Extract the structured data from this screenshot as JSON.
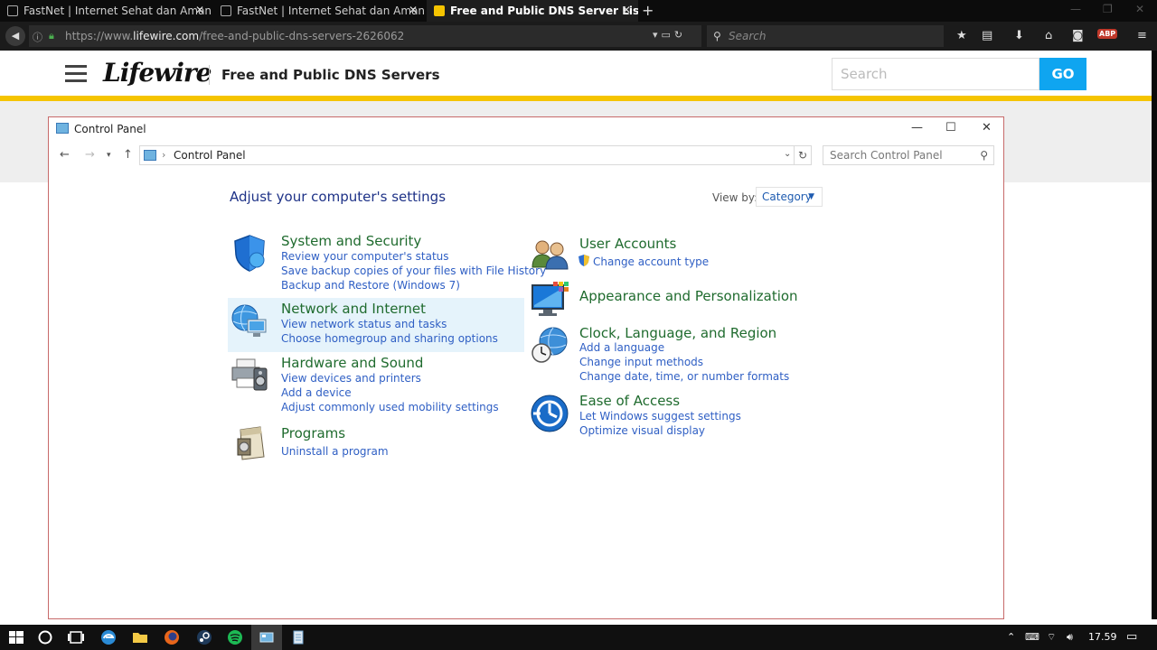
{
  "browser": {
    "tabs": [
      {
        "label": "FastNet | Internet Sehat dan Aman",
        "active": false
      },
      {
        "label": "FastNet | Internet Sehat dan Aman",
        "active": false
      },
      {
        "label": "Free and Public DNS Server List (Jul",
        "active": true
      }
    ],
    "url_prefix": "https://www.",
    "url_host": "lifewire.com",
    "url_path": "/free-and-public-dns-servers-2626062",
    "search_placeholder": "Search"
  },
  "lifewire": {
    "logo": "Lifewire",
    "title": "Free and Public DNS Servers",
    "search_placeholder": "Search",
    "go_label": "GO",
    "accent": "#f5c400",
    "go_color": "#0fa5f0"
  },
  "control_panel": {
    "window_title": "Control Panel",
    "breadcrumb": "Control Panel",
    "search_placeholder": "Search Control Panel",
    "heading": "Adjust your computer's settings",
    "view_by_label": "View by:",
    "view_by_value": "Category",
    "categories": [
      {
        "title": "System and Security",
        "icon": "shield-icon",
        "links": [
          "Review your computer's status",
          "Save backup copies of your files with File History",
          "Backup and Restore (Windows 7)"
        ]
      },
      {
        "title": "Network and Internet",
        "icon": "network-globe-icon",
        "links": [
          "View network status and tasks",
          "Choose homegroup and sharing options"
        ]
      },
      {
        "title": "Hardware and Sound",
        "icon": "printer-speaker-icon",
        "links": [
          "View devices and printers",
          "Add a device",
          "Adjust commonly used mobility settings"
        ]
      },
      {
        "title": "Programs",
        "icon": "programs-box-icon",
        "links": [
          "Uninstall a program"
        ]
      },
      {
        "title": "User Accounts",
        "icon": "users-icon",
        "links": [
          "Change account type"
        ]
      },
      {
        "title": "Appearance and Personalization",
        "icon": "monitor-palette-icon",
        "links": []
      },
      {
        "title": "Clock, Language, and Region",
        "icon": "clock-globe-icon",
        "links": [
          "Add a language",
          "Change input methods",
          "Change date, time, or number formats"
        ]
      },
      {
        "title": "Ease of Access",
        "icon": "ease-of-access-icon",
        "links": [
          "Let Windows suggest settings",
          "Optimize visual display"
        ]
      }
    ]
  },
  "taskbar": {
    "clock": "17.59"
  }
}
